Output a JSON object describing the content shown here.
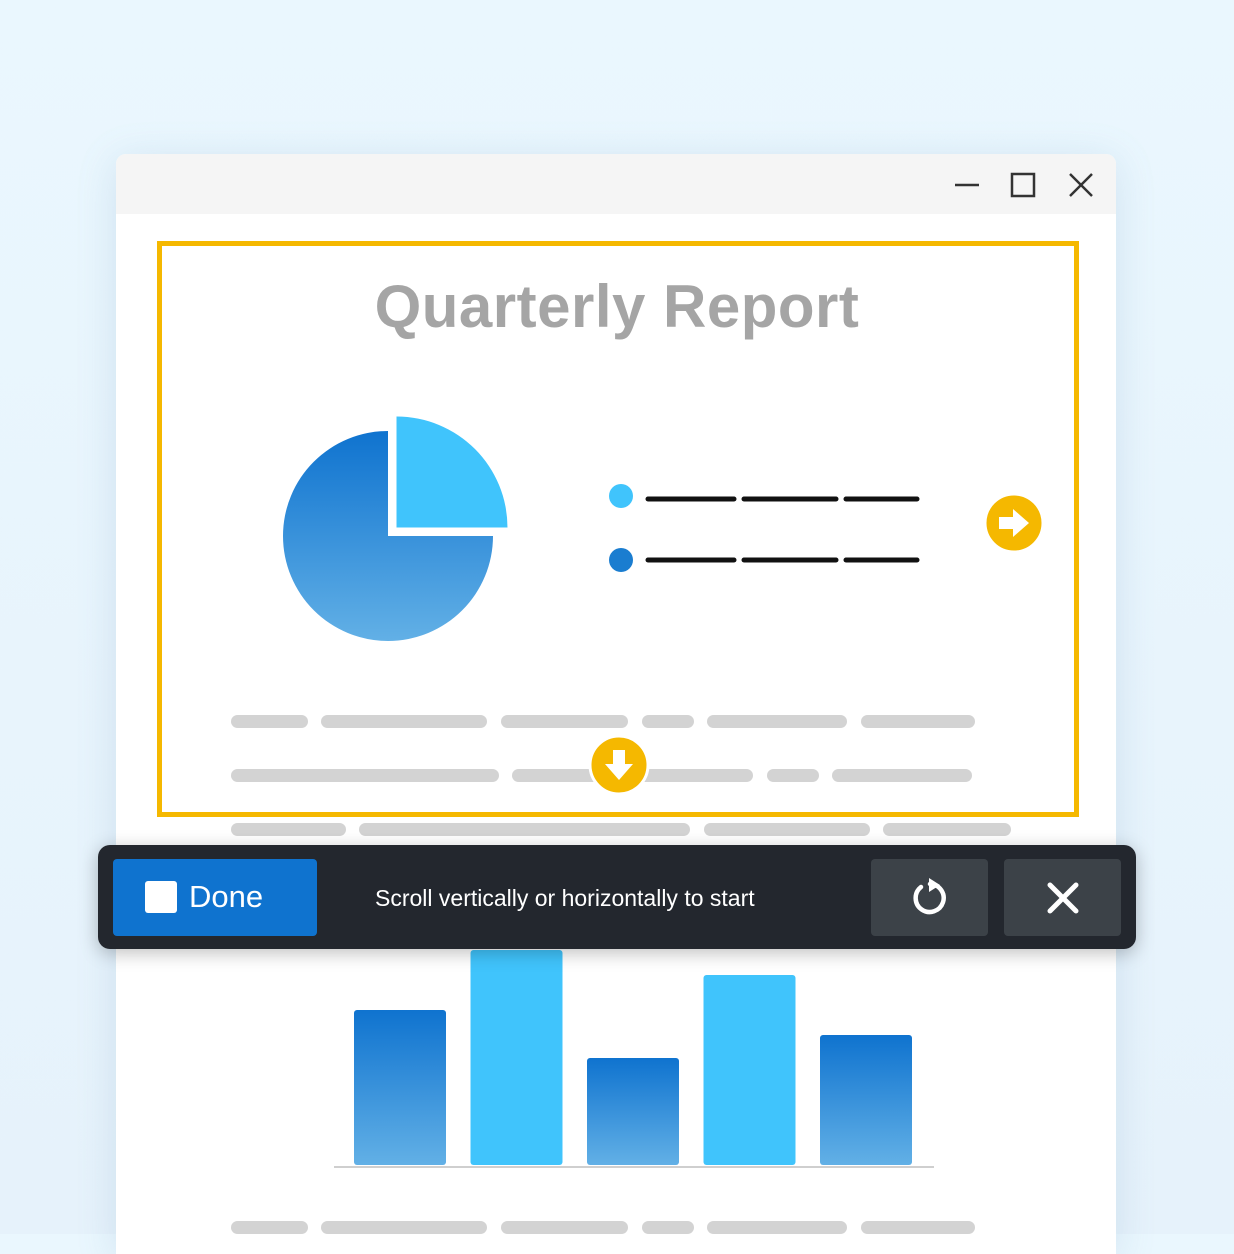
{
  "report": {
    "title": "Quarterly Report"
  },
  "window_controls": {
    "minimize_icon": "minimize-icon",
    "maximize_icon": "maximize-icon",
    "close_icon": "close-icon"
  },
  "scroll_toolbar": {
    "done_label": "Done",
    "instruction": "Scroll vertically or horizontally to start",
    "reset_icon": "rotate-ccw-icon",
    "close_icon": "x-icon"
  },
  "scroll_arrows": {
    "right_icon": "arrow-right-icon",
    "down_icon": "arrow-down-icon"
  },
  "colors": {
    "selection_border": "#f5b800",
    "accent_blue": "#0f73cf",
    "light_blue": "#40c4fc",
    "toolbar_bg": "#23272e",
    "toolbar_button": "#3c4248"
  },
  "chart_data": [
    {
      "type": "pie",
      "categories": [
        "",
        ""
      ],
      "values": [
        75,
        25
      ],
      "colors": [
        "#2a87d4",
        "#40c4fc"
      ],
      "exploded": [
        false,
        true
      ],
      "legend": "right"
    },
    {
      "type": "bar",
      "categories": [
        "",
        "",
        "",
        "",
        ""
      ],
      "values": [
        155,
        215,
        107,
        190,
        130
      ],
      "colors": [
        "#2a87d4",
        "#40c4fc",
        "#2a87d4",
        "#40c4fc",
        "#2a87d4"
      ],
      "ylim": [
        0,
        215
      ],
      "grid": false
    }
  ]
}
